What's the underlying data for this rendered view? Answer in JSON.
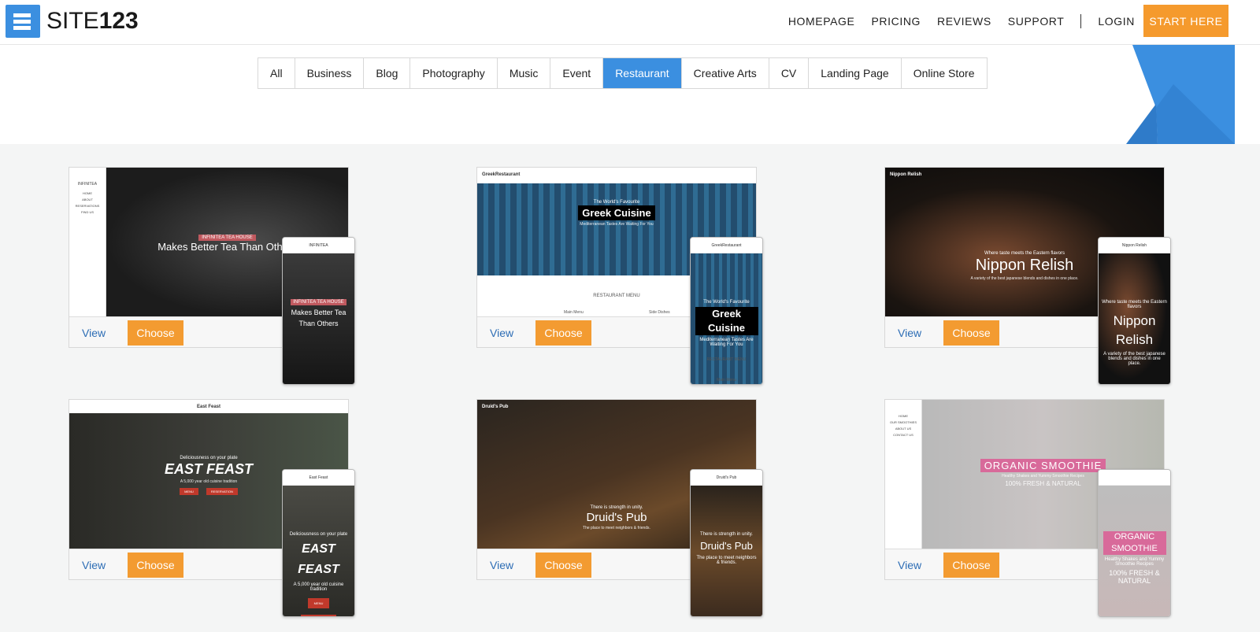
{
  "brand": {
    "name_light": "SITE",
    "name_bold": "123",
    "accent": "#3b8fe0",
    "cta": "#f59a2d"
  },
  "nav": {
    "items": [
      "HOMEPAGE",
      "PRICING",
      "REVIEWS",
      "SUPPORT"
    ],
    "login": "LOGIN",
    "start": "START HERE"
  },
  "categories": {
    "items": [
      "All",
      "Business",
      "Blog",
      "Photography",
      "Music",
      "Event",
      "Restaurant",
      "Creative Arts",
      "CV",
      "Landing Page",
      "Online Store"
    ],
    "active": "Restaurant"
  },
  "card_actions": {
    "view": "View",
    "choose": "Choose"
  },
  "templates": [
    {
      "style": "infinitea",
      "site": "INFINITEA",
      "desktop_tag": "INFINITEA TEA HOUSE",
      "desktop_title": "Makes Better Tea Than Others",
      "desktop_sub": "",
      "menu": [
        "HOME",
        "ABOUT",
        "RESERVATIONS",
        "FIND US"
      ],
      "mobile_tag": "INFINITEA TEA HOUSE",
      "mobile_title": "Makes Better Tea Than Others",
      "mobile_sub": ""
    },
    {
      "style": "greek",
      "site": "GreekRestaurant",
      "desktop_tag": "The World's Favourite",
      "desktop_title": "Greek Cuisine",
      "desktop_sub": "Mediterranean Tastes Are Waiting For You",
      "section": "RESTAURANT MENU",
      "cols": [
        "Main Menu",
        "Side Dishes"
      ],
      "mobile_tag": "The World's Favourite",
      "mobile_title": "Greek Cuisine",
      "mobile_sub": "Mediterranean Tastes Are Waiting For You",
      "mobile_section": "RESTAURANT MENU",
      "mobile_col": "Main Menu"
    },
    {
      "style": "nippon",
      "site": "Nippon Relish",
      "desktop_tag": "Where taste meets the Eastern flavors",
      "desktop_title": "Nippon Relish",
      "desktop_sub": "A variety of the best japanese blends and dishes in one place.",
      "mobile_tag": "Where taste meets the Eastern flavors",
      "mobile_title": "Nippon Relish",
      "mobile_sub": "A variety of the best japanese blends and dishes in one place."
    },
    {
      "style": "east",
      "site": "East Feast",
      "desktop_tag": "Deliciousness on your plate",
      "desktop_title": "EAST FEAST",
      "desktop_sub": "A 5,000 year old cuisine tradition",
      "buttons": [
        "MENU",
        "RESERVATION"
      ],
      "mobile_tag": "Deliciousness on your plate",
      "mobile_title": "EAST FEAST",
      "mobile_sub": "A 5,000 year old cuisine tradition"
    },
    {
      "style": "druid",
      "site": "Druid's Pub",
      "desktop_tag": "There is strength in unity.",
      "desktop_title": "Druid's Pub",
      "desktop_sub": "The place to meet neighbors & friends.",
      "mobile_tag": "There is strength in unity.",
      "mobile_title": "Druid's Pub",
      "mobile_sub": "The place to meet neighbors & friends."
    },
    {
      "style": "smoothie",
      "site": "",
      "desktop_tag": "",
      "desktop_title": "ORGANIC SMOOTHIE",
      "desktop_sub": "Healthy Shakes and Yummy Smoothie Recipes",
      "desktop_sub2": "100% FRESH & NATURAL",
      "menu": [
        "HOME",
        "OUR SMOOTHIES",
        "ABOUT US",
        "CONTACT US"
      ],
      "mobile_tag": "",
      "mobile_title": "ORGANIC SMOOTHIE",
      "mobile_sub": "Healthy Shakes and Yummy Smoothie Recipes",
      "mobile_sub2": "100% FRESH & NATURAL"
    }
  ]
}
